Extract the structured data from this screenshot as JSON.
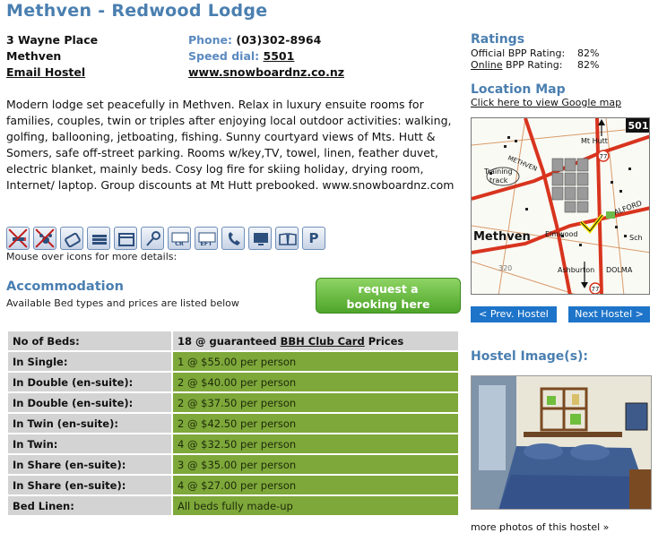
{
  "hostel": {
    "title": "Methven - Redwood Lodge",
    "address_line1": "3 Wayne Place",
    "address_line2": "Methven",
    "email_link": "Email Hostel",
    "phone_label": "Phone:",
    "phone": "(03)302-8964",
    "speed_label": "Speed dial:",
    "speed_dial": "5501",
    "website": "www.snowboardnz.co.nz",
    "description": "Modern lodge set peacefully in Methven. Relax in luxury ensuite rooms for families, couples, twin or triples after enjoying local outdoor activities: walking, golfing, ballooning, jetboating, fishing. Sunny courtyard views of Mts. Hutt & Somers, safe off-street parking. Rooms w/key,TV, towel, linen, feather duvet, electric blanket, mainly beds. Cosy log fire for skiing holiday, drying room, Internet/ laptop. Group discounts at Mt Hutt prebooked. www.snowboardnz.com"
  },
  "icons": {
    "hint": "Mouse over icons for more details:",
    "items": [
      {
        "name": "no-smoking-icon"
      },
      {
        "name": "no-pets-icon"
      },
      {
        "name": "luggage-storage-icon"
      },
      {
        "name": "linen-icon"
      },
      {
        "name": "kitchen-icon"
      },
      {
        "name": "key-icon"
      },
      {
        "name": "credit-card-icon",
        "label": "CR"
      },
      {
        "name": "eftpos-icon",
        "label": "EFT"
      },
      {
        "name": "phone-icon"
      },
      {
        "name": "tv-icon"
      },
      {
        "name": "book-exchange-icon"
      },
      {
        "name": "parking-icon",
        "label": "P"
      }
    ]
  },
  "accommodation": {
    "heading": "Accommodation",
    "subtitle": "Available Bed types and prices are listed below",
    "request_line1": "request a",
    "request_line2": "booking here",
    "head_key": "No of Beds:",
    "head_value_pre": "18 @ guaranteed ",
    "head_value_link": "BBH Club Card",
    "head_value_post": " Prices",
    "rows": [
      {
        "key": "In Single:",
        "value": "1 @ $55.00 per person"
      },
      {
        "key": "In Double (en-suite):",
        "value": "2 @ $40.00 per person"
      },
      {
        "key": "In Double (en-suite):",
        "value": "2 @ $37.50 per person"
      },
      {
        "key": "In Twin (en-suite):",
        "value": "2 @ $42.50 per person"
      },
      {
        "key": "In Twin:",
        "value": "4 @ $32.50 per person"
      },
      {
        "key": "In Share (en-suite):",
        "value": "3 @ $35.00 per person"
      },
      {
        "key": "In Share (en-suite):",
        "value": "4 @ $27.00 per person"
      },
      {
        "key": "Bed Linen:",
        "value": "All beds fully made-up"
      }
    ]
  },
  "sidebar": {
    "ratings_heading": "Ratings",
    "official_label": "Official BPP Rating:",
    "official_value": "82%",
    "online_label": "Online",
    "online_suffix": " BPP Rating:",
    "online_value": "82%",
    "location_heading": "Location Map",
    "map_link": "Click here to view Google map",
    "map_labels": {
      "number": "501",
      "mthutt": "Mt Hutt",
      "methven_top": "METHVEN",
      "training": "Training",
      "track": "track",
      "alford": "ALFORD",
      "elmwood": "Elmwood",
      "town": "Methven",
      "sch": "Sch",
      "ashburton": "Ashburton",
      "dolma": "DOLMA",
      "route77": "77",
      "route320": "320"
    },
    "prev_button": "< Prev. Hostel",
    "next_button": "Next Hostel >",
    "image_heading": "Hostel Image(s):",
    "more_photos": "more photos of this hostel »"
  },
  "colors": {
    "heading_blue": "#4a7fb0",
    "table_green": "#7ea83a",
    "table_grey": "#d3d3d3",
    "nav_button": "#1d74c9",
    "request_green": "#4ea52a"
  }
}
